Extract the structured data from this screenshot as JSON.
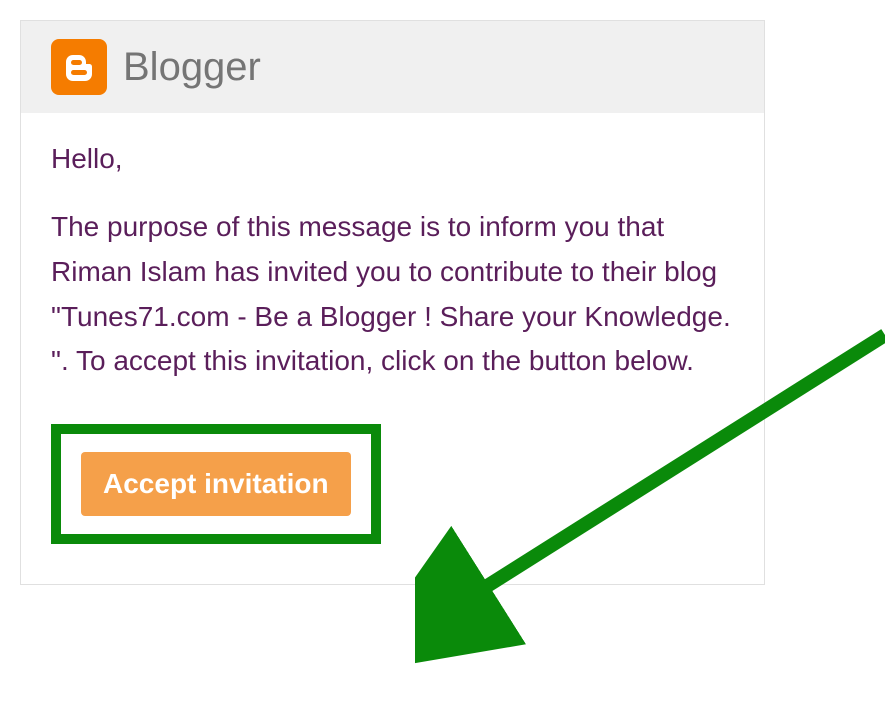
{
  "header": {
    "brand": "Blogger"
  },
  "content": {
    "greeting": "Hello,",
    "message": "The purpose of this message is to inform you that Riman Islam has invited you to contribute to their blog \"Tunes71.com - Be a Blogger ! Share your Knowledge. \". To accept this invitation, click on the button below.",
    "accept_button_label": "Accept invitation"
  }
}
